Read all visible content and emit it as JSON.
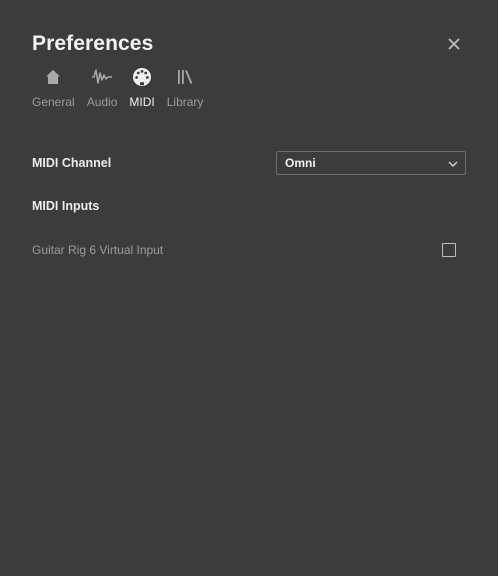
{
  "dialog": {
    "title": "Preferences"
  },
  "tabs": [
    {
      "label": "General",
      "icon": "home-icon"
    },
    {
      "label": "Audio",
      "icon": "waveform-icon"
    },
    {
      "label": "MIDI",
      "icon": "midi-connector-icon",
      "active": true
    },
    {
      "label": "Library",
      "icon": "library-icon"
    }
  ],
  "midi": {
    "channel_label": "MIDI Channel",
    "channel_value": "Omni",
    "inputs_heading": "MIDI Inputs",
    "inputs": [
      {
        "name": "Guitar Rig 6 Virtual Input",
        "checked": false
      }
    ]
  },
  "colors": {
    "background": "#3c3c3c",
    "text_active": "#f2f2f2",
    "text_muted": "#9a9a9a"
  }
}
